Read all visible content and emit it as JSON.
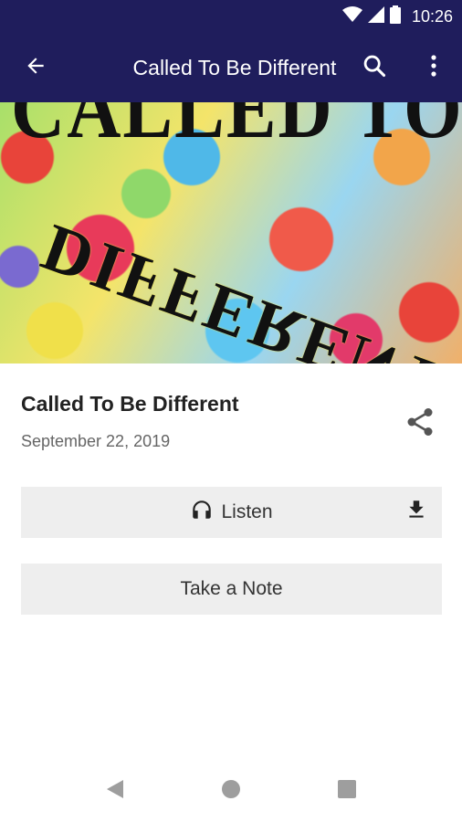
{
  "status_bar": {
    "time": "10:26",
    "icons": [
      "wifi-icon",
      "signal-icon",
      "battery-icon"
    ]
  },
  "app_bar": {
    "title": "Called To Be Different",
    "icons": [
      "back-arrow-icon",
      "search-icon",
      "more-vert-icon"
    ]
  },
  "hero": {
    "text_top": "CALLED TO BE",
    "text_rotated": "DIFFERENT"
  },
  "episode": {
    "title": "Called To Be Different",
    "date": "September 22, 2019"
  },
  "actions": {
    "listen_label": "Listen",
    "take_note_label": "Take a Note"
  },
  "nav_bar": {
    "icons": [
      "back-triangle-icon",
      "home-circle-icon",
      "recents-square-icon"
    ]
  },
  "colors": {
    "app_bar": "#1f1d5c",
    "button_bg": "#eeeeee",
    "date_text": "#666666"
  }
}
